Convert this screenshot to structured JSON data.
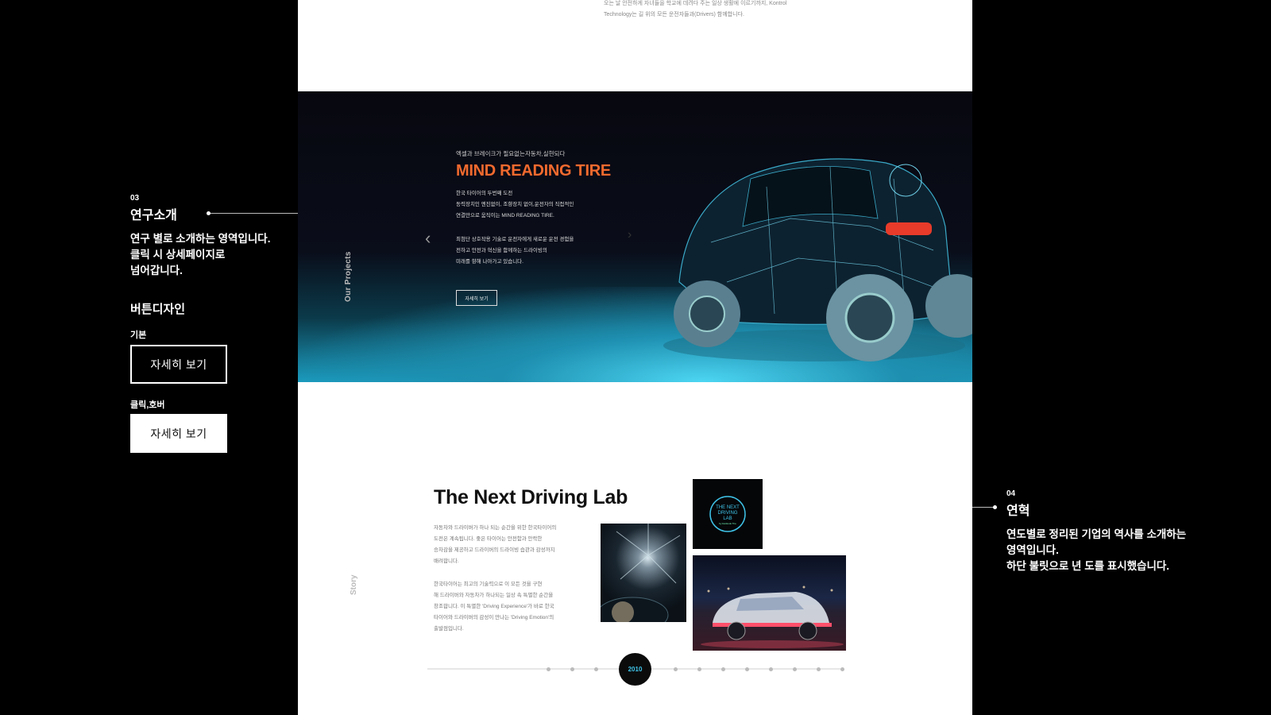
{
  "annotation_research": {
    "number": "03",
    "title": "연구소개",
    "description": "연구 별로 소개하는 영역입니다.\n클릭 시 상세페이지로\n넘어갑니다."
  },
  "button_design": {
    "title": "버튼디자인",
    "basic_label": "기본",
    "basic_button_text": "자세히 보기",
    "hover_label": "클릭,호버",
    "hover_button_text": "자세히 보기"
  },
  "annotation_history": {
    "number": "04",
    "title": "연혁",
    "description": "연도별로 정리된 기업의 역사를 소개하는\n영역입니다.\n하단 불릿으로 년 도를 표시했습니다."
  },
  "top_section": {
    "text": "오는 날 안전하게 자녀들을 학교에 데려다 주는 일상 생활에 이르기까지, Kontrol Technology는 길 위의 모든 운전자들과(Drivers) 함께합니다."
  },
  "projects": {
    "section_title": "Our Projects",
    "eyebrow": "엑셀과 브레이크가 필요없는자동차,실현되다",
    "headline": "MIND READING TIRE",
    "body1": "한국 타이어의 두번째 도전\n동력장치인 엔진없이, 조향장치 없이,운전자의 직접적인\n연결만으로 움직이는 MIND READING TIRE.",
    "body2": "최첨단 상호작용 기술로 운전자에게 새로운 운전 경험을\n전하고 안전과 혁신을 함께하는 드라이빙의\n미래를 향해 나아가고 있습니다.",
    "more_button": "자세히 보기",
    "prev_arrow": "‹",
    "next_arrow": "›"
  },
  "story": {
    "section_title": "Story",
    "title": "The Next Driving Lab",
    "paragraph1": "자동차와 드라이버가 하나 되는 순간을 위한 한국타이어의\n도전은 계속됩니다. 좋은 타이어는 안전함과 안락한\n승차감을 제공하고 드라이버의 드라이빙 습관과 감성까지\n배려합니다.",
    "paragraph2": "한국타이어는 최고의 기술력으로 이 모든 것을 구현\n해 드라이버와 자동차가 하나되는 일상 속 특별한 순간을\n창조합니다. 이 특별한 'Driving Experience'가 바로 한국\n타이어와 드라이버의 감성이 만나는 'Driving Emotion'의\n출발점입니다.",
    "logo_text_line1": "THE NEXT",
    "logo_text_line2": "DRIVING",
    "logo_text_line3": "LAB",
    "logo_text_small": "by Hankook Tire",
    "active_year": "2010"
  }
}
